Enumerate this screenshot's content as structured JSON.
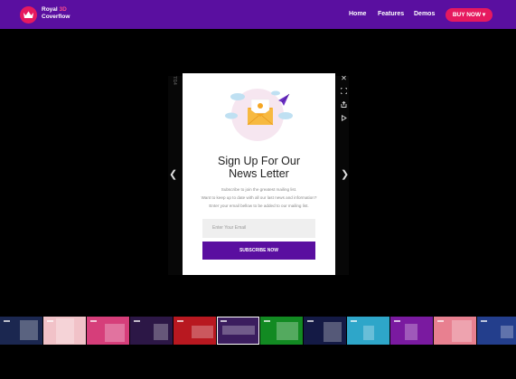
{
  "header": {
    "logo_line1": "Royal",
    "logo_accent": "3D",
    "logo_line2": "Coverflow",
    "nav": [
      "Home",
      "Features",
      "Demos"
    ],
    "buy_label": "BUY NOW ▾"
  },
  "lightbox": {
    "counter": "7/14",
    "prev_icon": "chevron-left-icon",
    "next_icon": "chevron-right-icon",
    "controls": [
      "close-icon",
      "fullscreen-icon",
      "share-icon",
      "play-icon"
    ]
  },
  "modal": {
    "title_line1": "Sign Up For Our",
    "title_line2": "News Letter",
    "desc_line1": "Subscribe to join the greatest mailing list.",
    "desc_line2": "Want to keep up to date with all our last news and information?",
    "desc_line3": "Enter your email bellow to be added to our mailing list.",
    "email_placeholder": "Enter Your Email",
    "subscribe_label": "SUBSCRIBE NOW"
  },
  "colors": {
    "brand": "#5a0fa0",
    "accent": "#e6195f",
    "modal_bg": "#ffffff"
  },
  "thumbnails": [
    {
      "bg": "#1b2750"
    },
    {
      "bg": "#f1c2c8"
    },
    {
      "bg": "#d63e7a"
    },
    {
      "bg": "#2c1746"
    },
    {
      "bg": "#b81820"
    },
    {
      "bg": "#3b1d5e"
    },
    {
      "bg": "#128a22"
    },
    {
      "bg": "#141a45"
    },
    {
      "bg": "#2ea6c9"
    },
    {
      "bg": "#7a1aa0"
    },
    {
      "bg": "#e88090"
    },
    {
      "bg": "#233e8c"
    }
  ]
}
